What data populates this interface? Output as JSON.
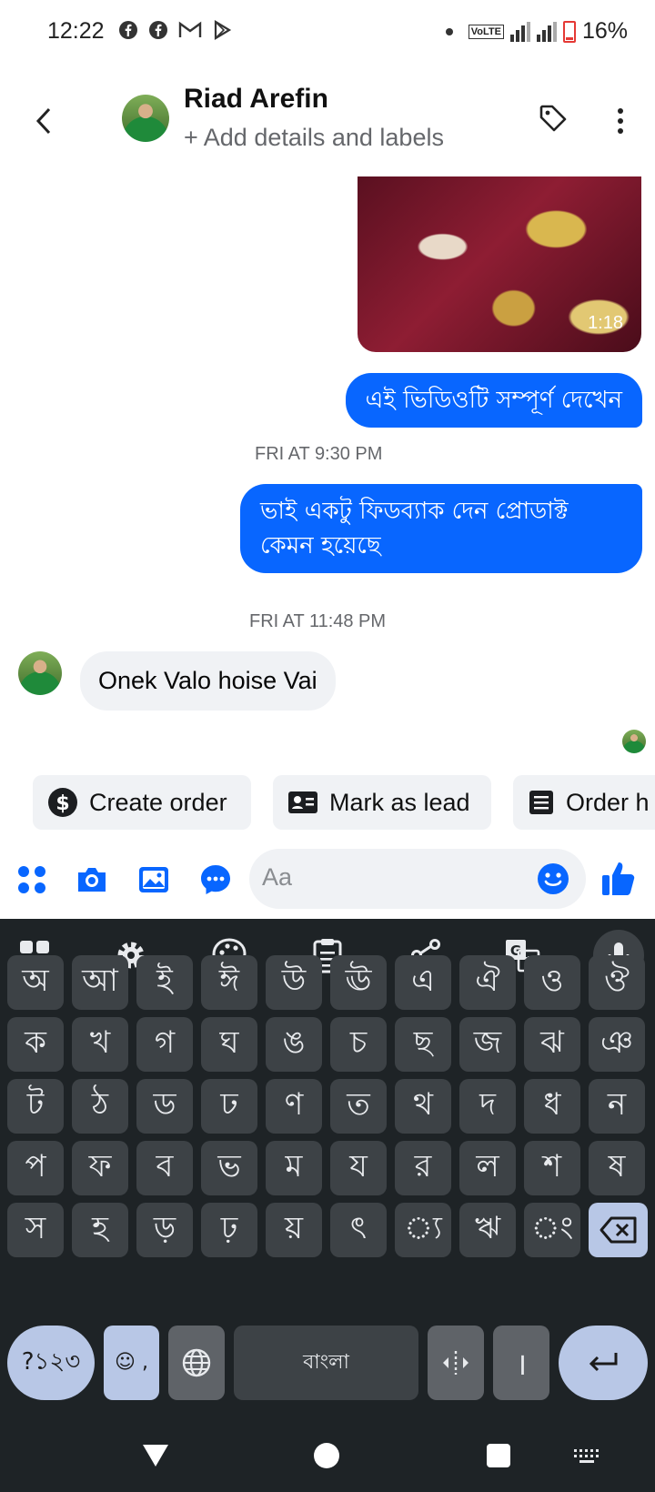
{
  "status_bar": {
    "time": "12:22",
    "volte": "VoLTE",
    "battery": "16%"
  },
  "header": {
    "name": "Riad Arefin",
    "subtitle": "+ Add details and labels"
  },
  "messages": {
    "video_duration": "1:18",
    "outgoing_1": "এই ভিডিওটি সম্পূর্ণ দেখেন",
    "timestamp_1": "FRI AT 9:30 PM",
    "outgoing_2": "ভাই একটু ফিডব্যাক দেন প্রোডাক্ট কেমন হয়েছে",
    "timestamp_2": "FRI AT 11:48 PM",
    "incoming_1": "Onek Valo hoise Vai"
  },
  "actions": {
    "create_order": "Create order",
    "mark_lead": "Mark as lead",
    "order_history": "Order h"
  },
  "composer": {
    "placeholder": "Aa"
  },
  "keyboard": {
    "row1": [
      "অ",
      "আ",
      "ই",
      "ঈ",
      "উ",
      "ঊ",
      "এ",
      "ঐ",
      "ও",
      "ঔ"
    ],
    "row2": [
      "ক",
      "খ",
      "গ",
      "ঘ",
      "ঙ",
      "চ",
      "ছ",
      "জ",
      "ঝ",
      "ঞ"
    ],
    "row3": [
      "ট",
      "ঠ",
      "ড",
      "ঢ",
      "ণ",
      "ত",
      "থ",
      "দ",
      "ধ",
      "ন"
    ],
    "row4": [
      "প",
      "ফ",
      "ব",
      "ভ",
      "ম",
      "য",
      "র",
      "ল",
      "শ",
      "ষ"
    ],
    "row5": [
      "স",
      "হ",
      "ড়",
      "ঢ়",
      "য়",
      "ৎ",
      "্য",
      "ঋ",
      "ং"
    ],
    "symbols": "?১২৩",
    "emoji_comma": "☺ ,",
    "space": "বাংলা",
    "danda": "।"
  },
  "colors": {
    "messenger_blue": "#0866ff",
    "bubble_gray": "#f0f2f5",
    "keyboard_bg": "#1e2326"
  }
}
